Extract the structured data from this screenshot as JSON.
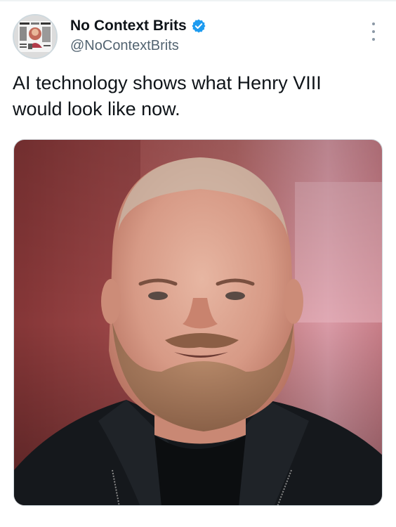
{
  "tweet": {
    "author": {
      "display_name": "No Context Brits",
      "handle": "@NoContextBrits",
      "verified": true,
      "verified_color": "#1d9bf0"
    },
    "text": "AI technology shows what Henry VIII\nwould look like now.",
    "media": {
      "description_icon": "photo",
      "alt": "Photo of a bearded man with a shaved head wearing a dark zip jacket"
    }
  },
  "icons": {
    "more": "more-vertical-icon",
    "verified": "verified-badge-icon",
    "avatar": "avatar-image"
  },
  "colors": {
    "text_primary": "#0f1419",
    "text_secondary": "#536471",
    "divider": "#eff3f4",
    "accent": "#1d9bf0"
  }
}
